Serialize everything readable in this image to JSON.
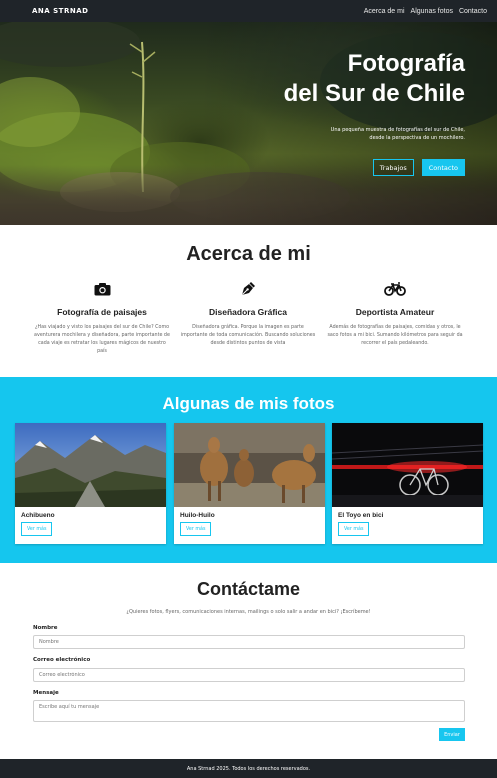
{
  "nav": {
    "brand": "ANA STRNAD",
    "links": [
      "Acerca de mi",
      "Algunas fotos",
      "Contacto"
    ]
  },
  "hero": {
    "title_line1": "Fotografía",
    "title_line2": "del Sur de Chile",
    "subtitle_line1": "Una pequeña muestra de fotografías del sur de Chile,",
    "subtitle_line2": "desde la perspectiva de un mochilero.",
    "button_work": "Trabajos",
    "button_contact": "Contacto"
  },
  "about": {
    "title": "Acerca de mi",
    "features": [
      {
        "icon": "camera-icon",
        "title": "Fotografía de paisajes",
        "text": "¿Has viajado y visto los paisajes del sur de Chile? Como aventurera mochilera y diseñadora, parte importante de cada viaje  es retratar los lugares mágicos de nuestro país"
      },
      {
        "icon": "pen-nib-icon",
        "title": "Diseñadora Gráfica",
        "text": "Diseñadora gráfica. Porque la imagen es parte importante de toda comunicación. Buscando soluciones desde distintos puntos de vista"
      },
      {
        "icon": "bicycle-icon",
        "title": "Deportista Amateur",
        "text": "Además de fotografías de paisajes, comidas y otros, le saco fotos a mi bici. Sumando kilómetros para seguir da recorrer el país pedaleando."
      }
    ]
  },
  "photos": {
    "title": "Algunas de mis fotos",
    "cards": [
      {
        "title": "Achibueno",
        "button": "Ver más"
      },
      {
        "title": "Huilo-Huilo",
        "button": "Ver más"
      },
      {
        "title": "El Toyo en bici",
        "button": "Ver más"
      }
    ]
  },
  "contact": {
    "title": "Contáctame",
    "intro": "¿Quieres fotos, flyers, comunicaciones internas, mailings o solo salir a andar en bici? ¡Escríbeme!",
    "name_label": "Nombre",
    "name_placeholder": "Nombre",
    "email_label": "Correo electrónico",
    "email_placeholder": "Correo electrónico",
    "message_label": "Mensaje",
    "message_placeholder": "Escribe aquí tu mensaje",
    "submit": "Enviar"
  },
  "footer": {
    "text": "Ana Strnad 2025. Todos los derechos reservados."
  },
  "colors": {
    "accent": "#17c6ef",
    "dark": "#1f2429"
  }
}
